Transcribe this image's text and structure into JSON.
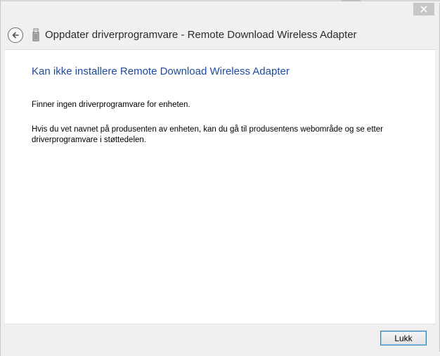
{
  "window": {
    "title": "Oppdater driverprogramvare - Remote Download Wireless Adapter"
  },
  "content": {
    "heading": "Kan ikke installere Remote Download Wireless Adapter",
    "message1": "Finner ingen driverprogramvare for enheten.",
    "message2": "Hvis du vet navnet på produsenten av enheten, kan du gå til produsentens webområde og se etter driverprogramvare i støttedelen."
  },
  "footer": {
    "close_label": "Lukk"
  },
  "icons": {
    "back": "back-arrow-icon",
    "device": "usb-device-icon",
    "close": "close-icon"
  },
  "colors": {
    "heading": "#1e4a9e",
    "close_button_bg": "#c7c7c7",
    "button_border": "#3c7fb1"
  }
}
